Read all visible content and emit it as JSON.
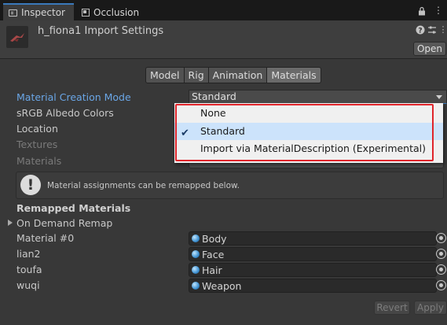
{
  "tabs": [
    {
      "label": "Inspector",
      "icon": "inspector-icon"
    },
    {
      "label": "Occlusion",
      "icon": "occlusion-icon"
    }
  ],
  "header": {
    "title": "h_fiona1 Import Settings",
    "open_label": "Open"
  },
  "subtabs": [
    "Model",
    "Rig",
    "Animation",
    "Materials"
  ],
  "selected_subtab": "Materials",
  "fields": {
    "material_creation_mode": {
      "label": "Material Creation Mode",
      "value": "Standard"
    },
    "srgb_albedo": {
      "label": "sRGB Albedo Colors"
    },
    "location": {
      "label": "Location"
    },
    "textures": {
      "label": "Textures"
    },
    "materials": {
      "label": "Materials"
    }
  },
  "dropdown": {
    "options": [
      "None",
      "Standard",
      "Import via MaterialDescription (Experimental)"
    ],
    "selected": "Standard"
  },
  "help": {
    "text": "Material assignments can be remapped below."
  },
  "remapped": {
    "title": "Remapped Materials",
    "on_demand_label": "On Demand Remap",
    "rows": [
      {
        "label": "Material #0",
        "value": "Body"
      },
      {
        "label": "lian2",
        "value": "Face"
      },
      {
        "label": "toufa",
        "value": "Hair"
      },
      {
        "label": "wuqi",
        "value": "Weapon"
      }
    ]
  },
  "buttons": {
    "revert": "Revert",
    "apply": "Apply"
  },
  "colors": {
    "accent": "#3a79bb",
    "highlight_border": "#e0252b",
    "selection": "#cce3fb"
  }
}
